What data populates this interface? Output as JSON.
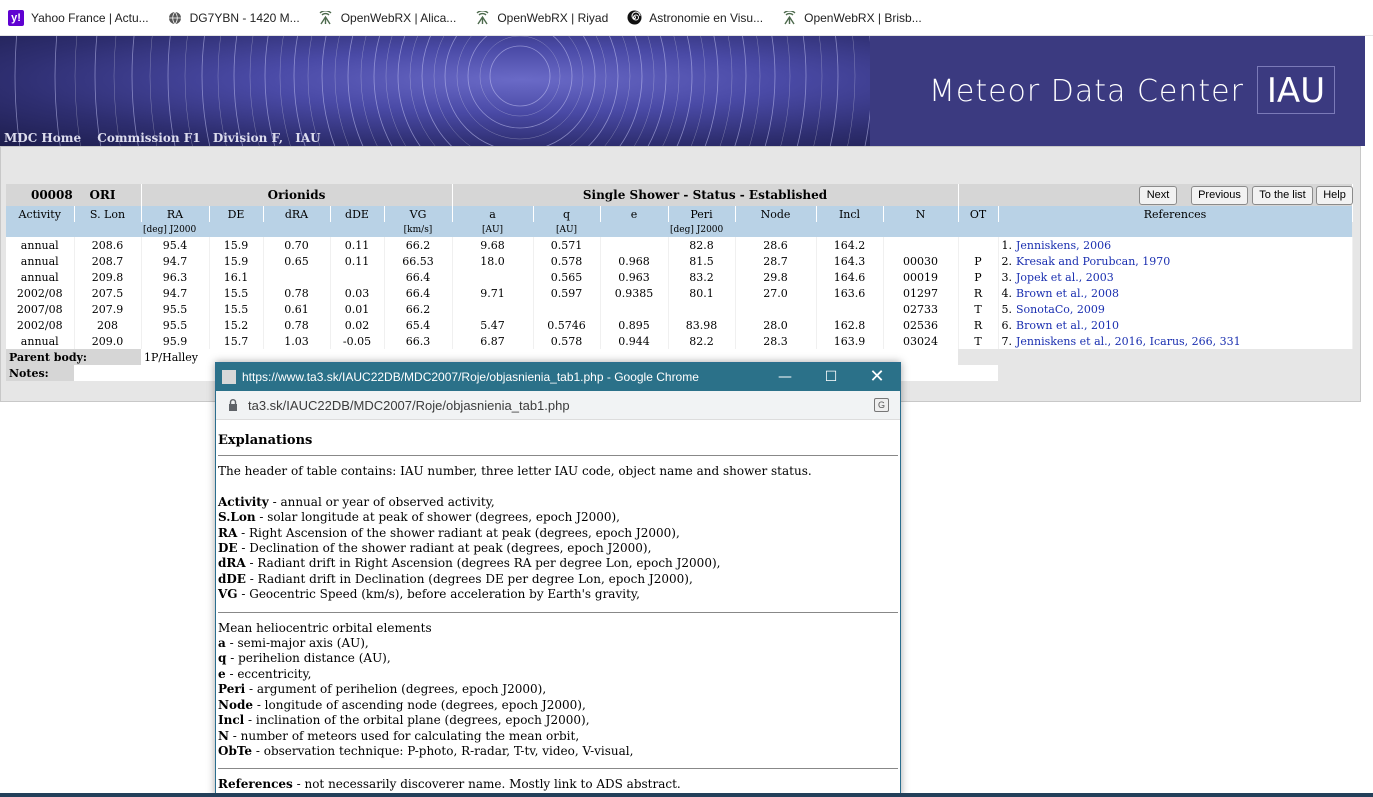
{
  "bookmarks": [
    {
      "icon": "yahoo-icon",
      "label": "Yahoo France | Actu..."
    },
    {
      "icon": "globe-icon",
      "label": "DG7YBN - 1420 M..."
    },
    {
      "icon": "openwebrx-icon",
      "label": "OpenWebRX | Alica..."
    },
    {
      "icon": "openwebrx-icon",
      "label": "OpenWebRX | Riyad"
    },
    {
      "icon": "spiral-icon",
      "label": "Astronomie en Visu..."
    },
    {
      "icon": "openwebrx-icon",
      "label": "OpenWebRX | Brisb..."
    }
  ],
  "header": {
    "title": "Meteor Data Center",
    "logo": "IAU",
    "nav": [
      "MDC Home",
      "Commission F1",
      "Division F,",
      "IAU"
    ]
  },
  "shower": {
    "number": "00008",
    "code": "ORI",
    "name": "Orionids",
    "status": "Single Shower - Status - Established",
    "buttons": [
      "Next",
      "Previous",
      "To the list",
      "Help"
    ],
    "columns": [
      "Activity",
      "S. Lon",
      "RA",
      "DE",
      "dRA",
      "dDE",
      "VG",
      "a",
      "q",
      "e",
      "Peri",
      "Node",
      "Incl",
      "N",
      "OT",
      "References"
    ],
    "units": {
      "radec": "[deg]   J2000",
      "vg": "[km/s]",
      "a": "[AU]",
      "q": "[AU]",
      "angles": "[deg]   J2000"
    },
    "rows": [
      {
        "activity": "annual",
        "slon": "208.6",
        "ra": "95.4",
        "de": "15.9",
        "dra": "0.70",
        "dde": "0.11",
        "vg": "66.2",
        "a": "9.68",
        "q": "0.571",
        "e": "",
        "peri": "82.8",
        "node": "28.6",
        "incl": "164.2",
        "n": "",
        "ot": "",
        "ref_no": "1.",
        "ref": "Jenniskens, 2006"
      },
      {
        "activity": "annual",
        "slon": "208.7",
        "ra": "94.7",
        "de": "15.9",
        "dra": "0.65",
        "dde": "0.11",
        "vg": "66.53",
        "a": "18.0",
        "q": "0.578",
        "e": "0.968",
        "peri": "81.5",
        "node": "28.7",
        "incl": "164.3",
        "n": "00030",
        "ot": "P",
        "ref_no": "2.",
        "ref": "Kresak and Porubcan, 1970"
      },
      {
        "activity": "annual",
        "slon": "209.8",
        "ra": "96.3",
        "de": "16.1",
        "dra": "",
        "dde": "",
        "vg": "66.4",
        "a": "",
        "q": "0.565",
        "e": "0.963",
        "peri": "83.2",
        "node": "29.8",
        "incl": "164.6",
        "n": "00019",
        "ot": "P",
        "ref_no": "3.",
        "ref": "Jopek et al., 2003"
      },
      {
        "activity": "2002/08",
        "slon": "207.5",
        "ra": "94.7",
        "de": "15.5",
        "dra": "0.78",
        "dde": "0.03",
        "vg": "66.4",
        "a": "9.71",
        "q": "0.597",
        "e": "0.9385",
        "peri": "80.1",
        "node": "27.0",
        "incl": "163.6",
        "n": "01297",
        "ot": "R",
        "ref_no": "4.",
        "ref": "Brown et al., 2008"
      },
      {
        "activity": "2007/08",
        "slon": "207.9",
        "ra": "95.5",
        "de": "15.5",
        "dra": "0.61",
        "dde": "0.01",
        "vg": "66.2",
        "a": "",
        "q": "",
        "e": "",
        "peri": "",
        "node": "",
        "incl": "",
        "n": "02733",
        "ot": "T",
        "ref_no": "5.",
        "ref": "SonotaCo, 2009"
      },
      {
        "activity": "2002/08",
        "slon": "208",
        "ra": "95.5",
        "de": "15.2",
        "dra": "0.78",
        "dde": "0.02",
        "vg": "65.4",
        "a": "5.47",
        "q": "0.5746",
        "e": "0.895",
        "peri": "83.98",
        "node": "28.0",
        "incl": "162.8",
        "n": "02536",
        "ot": "R",
        "ref_no": "6.",
        "ref": "Brown et al., 2010"
      },
      {
        "activity": "annual",
        "slon": "209.0",
        "ra": "95.9",
        "de": "15.7",
        "dra": "1.03",
        "dde": "-0.05",
        "vg": "66.3",
        "a": "6.87",
        "q": "0.578",
        "e": "0.944",
        "peri": "82.2",
        "node": "28.3",
        "incl": "163.9",
        "n": "03024",
        "ot": "T",
        "ref_no": "7.",
        "ref": "Jenniskens et al., 2016, Icarus, 266, 331"
      }
    ],
    "parent_label": "Parent body:",
    "parent_value": "1P/Halley",
    "notes_label": "Notes:"
  },
  "popup": {
    "title": "https://www.ta3.sk/IAUC22DB/MDC2007/Roje/objasnienia_tab1.php - Google Chrome",
    "address": "ta3.sk/IAUC22DB/MDC2007/Roje/objasnienia_tab1.php",
    "heading": "Explanations",
    "intro": "The header of table contains: IAU number, three letter IAU code, object name and shower status.",
    "items1": [
      {
        "term": "Activity",
        "desc": " - annual or year of observed activity,"
      },
      {
        "term": "S.Lon",
        "desc": " - solar longitude at peak of shower (degrees, epoch J2000),"
      },
      {
        "term": "RA",
        "desc": " - Right Ascension of the shower radiant at peak (degrees, epoch J2000),"
      },
      {
        "term": "DE",
        "desc": " - Declination of the shower radiant at peak (degrees, epoch J2000),"
      },
      {
        "term": "dRA",
        "desc": " - Radiant drift in Right Ascension (degrees RA per degree Lon, epoch J2000),"
      },
      {
        "term": "dDE",
        "desc": " - Radiant drift in Declination (degrees DE per degree Lon, epoch J2000),"
      },
      {
        "term": "VG",
        "desc": " - Geocentric Speed (km/s), before acceleration by Earth's gravity,"
      }
    ],
    "orbital_heading": "Mean heliocentric orbital elements",
    "items2": [
      {
        "term": "a",
        "desc": " - semi-major axis (AU),"
      },
      {
        "term": "q",
        "desc": " - perihelion distance (AU),"
      },
      {
        "term": "e",
        "desc": " - eccentricity,"
      },
      {
        "term": "Peri",
        "desc": " - argument of perihelion (degrees, epoch J2000),"
      },
      {
        "term": "Node",
        "desc": " - longitude of ascending node (degrees, epoch J2000),"
      },
      {
        "term": "Incl",
        "desc": " - inclination of the orbital plane (degrees, epoch J2000),"
      },
      {
        "term": "N",
        "desc": " - number of meteors used for calculating the mean orbit,"
      },
      {
        "term": "ObTe",
        "desc": " - observation technique: P-photo, R-radar, T-tv, video, V-visual,"
      }
    ],
    "refs_term": "References",
    "refs_desc": " - not necessarily discoverer name. Mostly link to ADS abstract."
  }
}
